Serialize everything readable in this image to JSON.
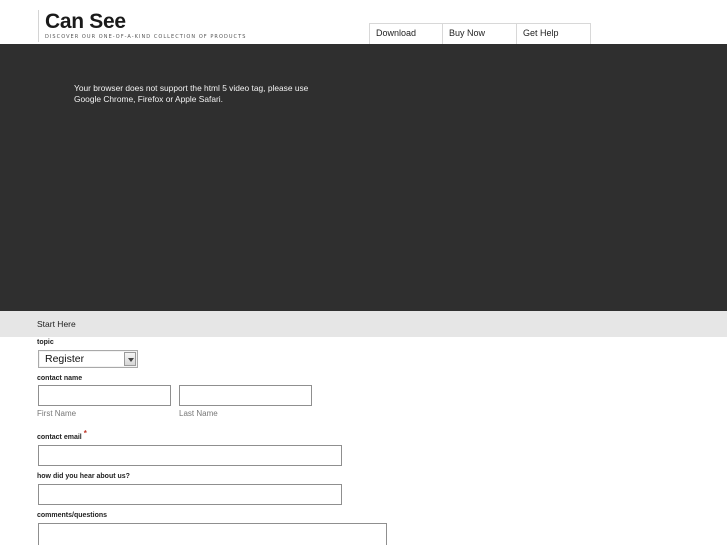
{
  "header": {
    "brand": "Can See",
    "tagline": "DISCOVER OUR ONE-OF-A-KIND COLLECTION OF PRODUCTS",
    "nav": [
      "Download",
      "Buy Now",
      "Get Help"
    ]
  },
  "video": {
    "fallback_text": "Your browser does not support the html 5 video tag, please use Google Chrome, Firefox or Apple Safari."
  },
  "section": {
    "title": "Start Here"
  },
  "form": {
    "topic_label": "topic",
    "topic_value": "Register",
    "contact_name_label": "contact name",
    "first_name_hint": "First Name",
    "last_name_hint": "Last Name",
    "contact_email_label": "contact email",
    "required_mark": "*",
    "hear_label": "how did you hear about us?",
    "comments_label": "comments/questions"
  }
}
